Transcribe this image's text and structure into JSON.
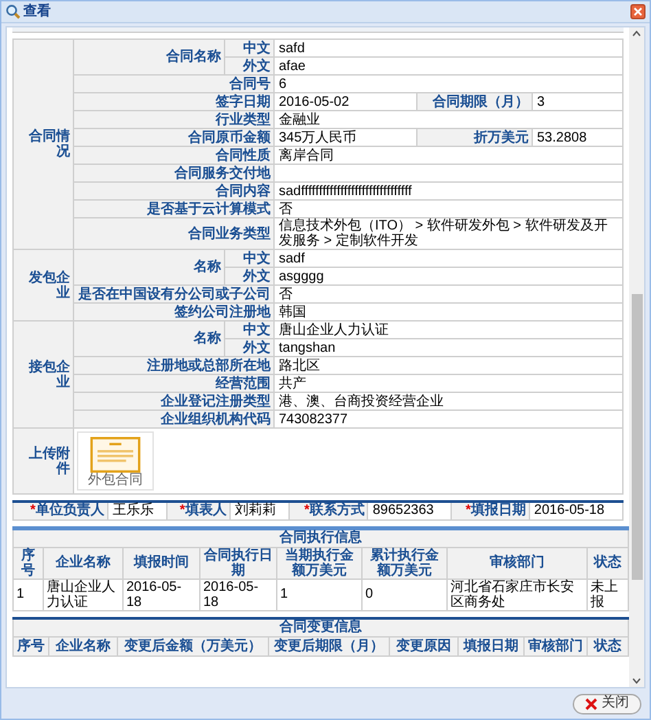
{
  "window": {
    "title": "查看"
  },
  "contract_sections": [
    {
      "label": "合同情况",
      "rows": [
        {
          "label": "合同名称",
          "parts": [
            {
              "label": "中文",
              "value": "safd"
            },
            {
              "label": "外文",
              "value": "afae"
            }
          ]
        },
        {
          "label": "合同号",
          "value": "6"
        },
        {
          "label": "签字日期",
          "value": "2016-05-02",
          "side_label": "合同期限（月）",
          "side_value": "3"
        },
        {
          "label": "行业类型",
          "value": "金融业"
        },
        {
          "label": "合同原币金额",
          "value": "345万人民币",
          "side_label": "折万美元",
          "side_value": "53.2808"
        },
        {
          "label": "合同性质",
          "value": "离岸合同"
        },
        {
          "label": "合同服务交付地"
        },
        {
          "label": "合同内容",
          "value": "sadfffffffffffffffffffffffffffffff"
        },
        {
          "label": "是否基于云计算模式",
          "value": "否"
        },
        {
          "label": "合同业务类型",
          "value": "信息技术外包（ITO） > 软件研发外包 > 软件研发及开发服务 > 定制软件开发"
        }
      ]
    },
    {
      "label": "发包企业",
      "rows": [
        {
          "label": "名称",
          "parts": [
            {
              "label": "中文",
              "value": "sadf"
            },
            {
              "label": "外文",
              "value": "asgggg"
            }
          ]
        },
        {
          "label": "是否在中国设有分公司或子公司",
          "value": "否"
        },
        {
          "label": "签约公司注册地",
          "value": "韩国"
        }
      ]
    },
    {
      "label": "接包企业",
      "rows": [
        {
          "label": "名称",
          "parts": [
            {
              "label": "中文",
              "value": "唐山企业人力认证"
            },
            {
              "label": "外文",
              "value": "tangshan"
            }
          ]
        },
        {
          "label": "注册地或总部所在地",
          "value": "路北区"
        },
        {
          "label": "经营范围",
          "value": "共产"
        },
        {
          "label": "企业登记注册类型",
          "value": "港、澳、台商投资经营企业"
        },
        {
          "label": "企业组织机构代码",
          "value": "743082377"
        }
      ]
    }
  ],
  "attachments": {
    "label": "上传附件",
    "files": [
      {
        "name": "外包合同"
      }
    ]
  },
  "signers": [
    {
      "mark": "*",
      "label": "单位负责人",
      "value": "王乐乐"
    },
    {
      "mark": "*",
      "label": "填表人",
      "value": "刘莉莉"
    },
    {
      "mark": "*",
      "label": "联系方式",
      "value": "89652363"
    },
    {
      "mark": "*",
      "label": "填报日期",
      "value": "2016-05-18"
    }
  ],
  "execution": {
    "title": "合同执行信息",
    "columns": [
      "序号",
      "企业名称",
      "填报时间",
      "合同执行日期",
      "当期执行金额万美元",
      "累计执行金额万美元",
      "审核部门",
      "状态"
    ],
    "rows": [
      [
        "1",
        "唐山企业人力认证",
        "2016-05-18",
        "2016-05-18",
        "1",
        "0",
        "河北省石家庄市长安区商务处",
        "未上报"
      ]
    ]
  },
  "changes": {
    "title": "合同变更信息",
    "columns": [
      "序号",
      "企业名称",
      "变更后金额（万美元）",
      "变更后期限（月）",
      "变更原因",
      "填报日期",
      "审核部门",
      "状态"
    ]
  },
  "close_button": "关闭"
}
